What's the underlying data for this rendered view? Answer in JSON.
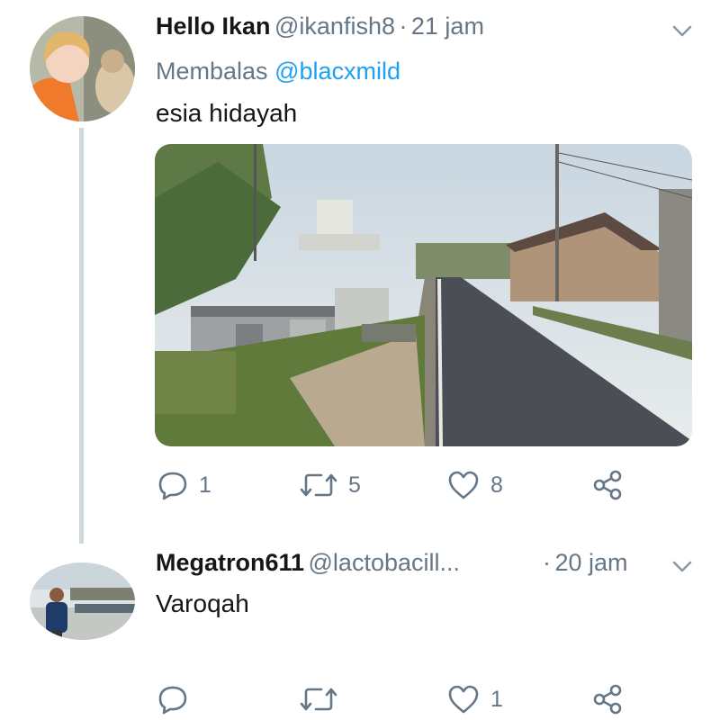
{
  "tweet1": {
    "display_name": "Hello Ikan",
    "handle": "@ikanfish8",
    "separator": "·",
    "time": "21 jam",
    "reply_prefix": "Membalas",
    "reply_mention": "@blacxmild",
    "text": "esia hidayah",
    "actions": {
      "replies": "1",
      "retweets": "5",
      "likes": "8"
    }
  },
  "tweet2": {
    "display_name": "Megatron611",
    "handle": "@lactobacill...",
    "separator": "·",
    "time": "20 jam",
    "text": "Varoqah",
    "actions": {
      "replies": "",
      "retweets": "",
      "likes": "1"
    }
  },
  "colors": {
    "accent": "#1da1f2",
    "muted": "#657786",
    "text": "#14171a",
    "thread_line": "#cfd8dc"
  },
  "icons": [
    "reply-icon",
    "retweet-icon",
    "like-icon",
    "share-icon",
    "chevron-down-icon"
  ]
}
